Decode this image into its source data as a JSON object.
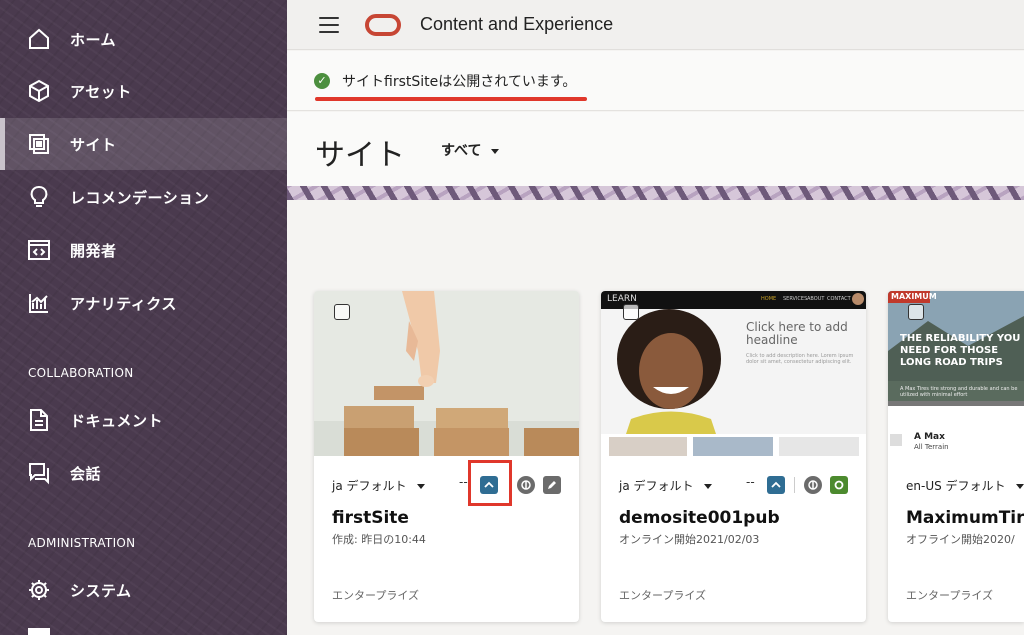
{
  "app": {
    "title": "Content and Experience"
  },
  "sidebar": {
    "items": [
      {
        "label": "ホーム",
        "icon": "home-icon"
      },
      {
        "label": "アセット",
        "icon": "cube-icon"
      },
      {
        "label": "サイト",
        "icon": "sites-icon",
        "active": true
      },
      {
        "label": "レコメンデーション",
        "icon": "lightbulb-icon"
      },
      {
        "label": "開発者",
        "icon": "code-window-icon"
      },
      {
        "label": "アナリティクス",
        "icon": "analytics-icon"
      }
    ],
    "collaboration_heading": "COLLABORATION",
    "collaboration_items": [
      {
        "label": "ドキュメント",
        "icon": "document-icon"
      },
      {
        "label": "会話",
        "icon": "conversation-icon"
      }
    ],
    "administration_heading": "ADMINISTRATION",
    "administration_items": [
      {
        "label": "システム",
        "icon": "gear-icon"
      }
    ]
  },
  "notification": {
    "text": "サイトfirstSiteは公開されています。"
  },
  "page": {
    "title": "サイト",
    "filter_label": "すべて"
  },
  "cards": [
    {
      "language": "ja デフォルト",
      "dash": "--",
      "name": "firstSite",
      "subtitle": "作成: 昨日の10:44",
      "type": "エンタープライズ"
    },
    {
      "language": "ja デフォルト",
      "dash": "--",
      "name": "demosite001pub",
      "subtitle": "オンライン開始2021/02/03",
      "type": "エンタープライズ",
      "preview": {
        "brand": "LEARN",
        "nav": [
          "HOME",
          "SERVICES",
          "ABOUT",
          "CONTACT"
        ],
        "headline": "Click here to add headline",
        "body": "Click to add description here. Lorem ipsum dolor sit amet, consectetur adipiscing elit."
      }
    },
    {
      "language": "en-US デフォルト",
      "name": "MaximumTire",
      "subtitle": "オフライン開始2020/",
      "type": "エンタープライズ",
      "preview": {
        "brand": "MAXIMUM",
        "headline": "THE RELIABILITY YOU NEED FOR THOSE LONG ROAD TRIPS",
        "body": "A Max Tires tire strong and durable and can be utilized with minimal effort",
        "product": "A Max",
        "product_sub": "All Terrain"
      }
    }
  ],
  "colors": {
    "sidebar": "#4a3a4e",
    "accent_red": "#c74634",
    "highlight": "#e0372b",
    "publish_blue": "#2f6d93",
    "success_green": "#4c8f3f"
  }
}
